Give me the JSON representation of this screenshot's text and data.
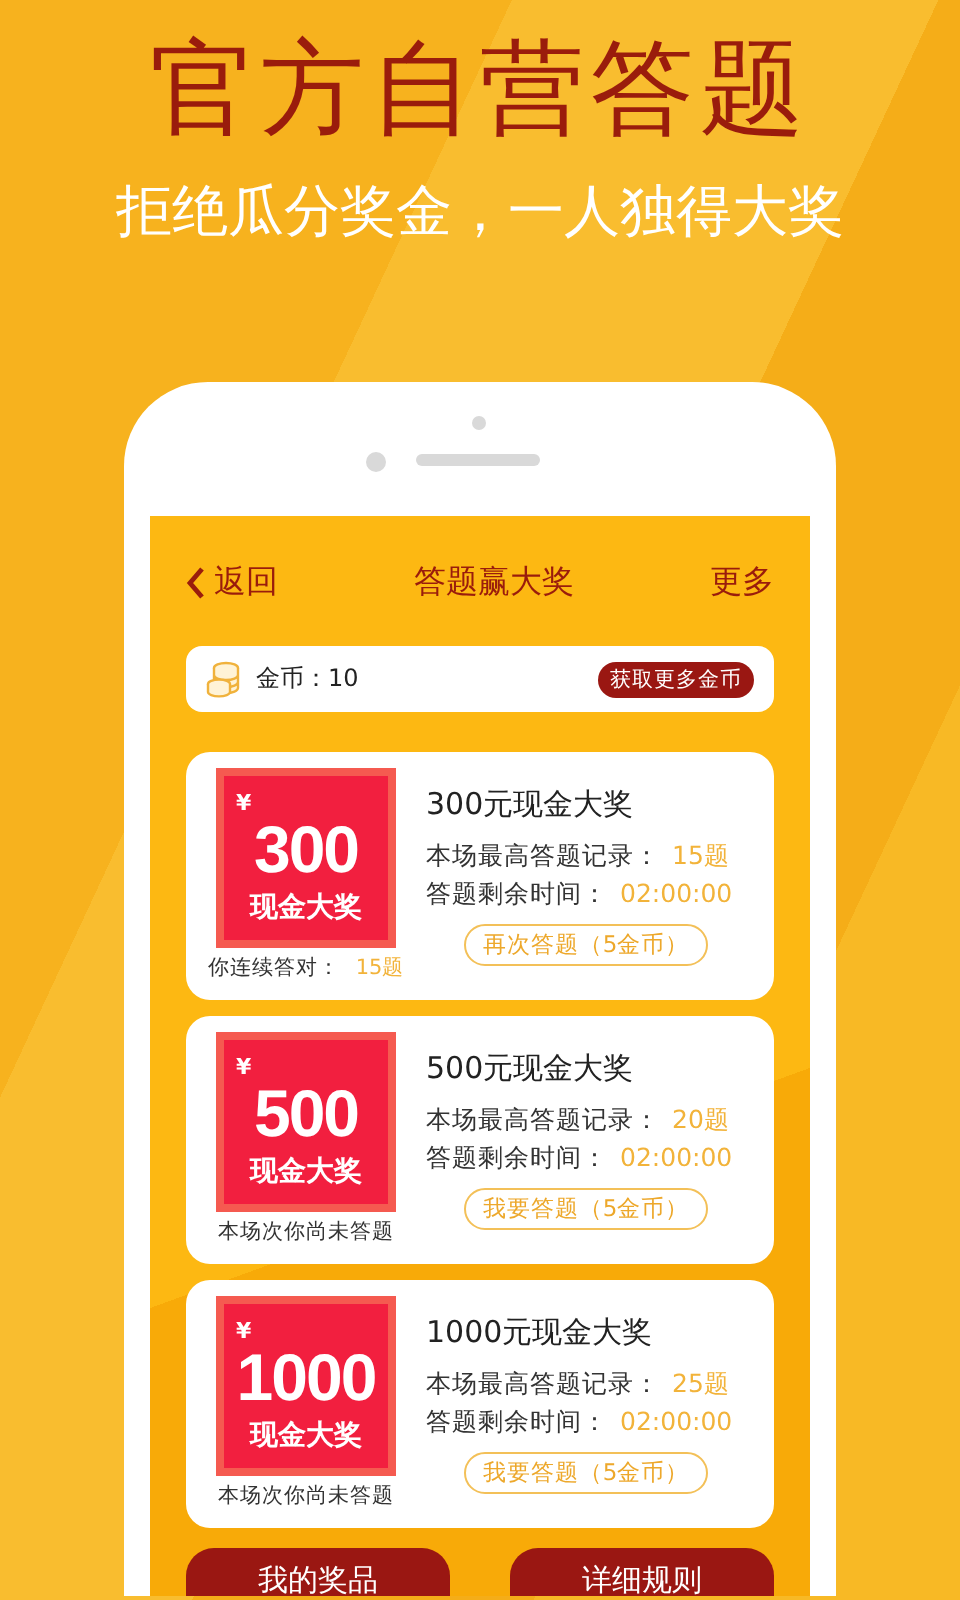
{
  "promo": {
    "title": "官方自营答题",
    "subtitle": "拒绝瓜分奖金，一人独得大奖"
  },
  "nav": {
    "back": "返回",
    "title": "答题赢大奖",
    "more": "更多"
  },
  "coins": {
    "text": "金币：10",
    "button": "获取更多金币"
  },
  "prizes": [
    {
      "currency": "¥",
      "amount": "300",
      "tile_label": "现金大奖",
      "title": "300元现金大奖",
      "record_label": "本场最高答题记录：",
      "record_value": "15题",
      "time_label": "答题剩余时间：",
      "time_value": "02:00:00",
      "note_label": "你连续答对：",
      "note_value": "15题",
      "button": "再次答题（5金币）"
    },
    {
      "currency": "¥",
      "amount": "500",
      "tile_label": "现金大奖",
      "title": "500元现金大奖",
      "record_label": "本场最高答题记录：",
      "record_value": "20题",
      "time_label": "答题剩余时间：",
      "time_value": "02:00:00",
      "note_label": "本场次你尚未答题",
      "button": "我要答题（5金币）"
    },
    {
      "currency": "¥",
      "amount": "1000",
      "tile_label": "现金大奖",
      "title": "1000元现金大奖",
      "record_label": "本场最高答题记录：",
      "record_value": "25题",
      "time_label": "答题剩余时间：",
      "time_value": "02:00:00",
      "note_label": "本场次你尚未答题",
      "button": "我要答题（5金币）"
    }
  ],
  "bottom_buttons": [
    "我的奖品",
    "详细规则"
  ]
}
